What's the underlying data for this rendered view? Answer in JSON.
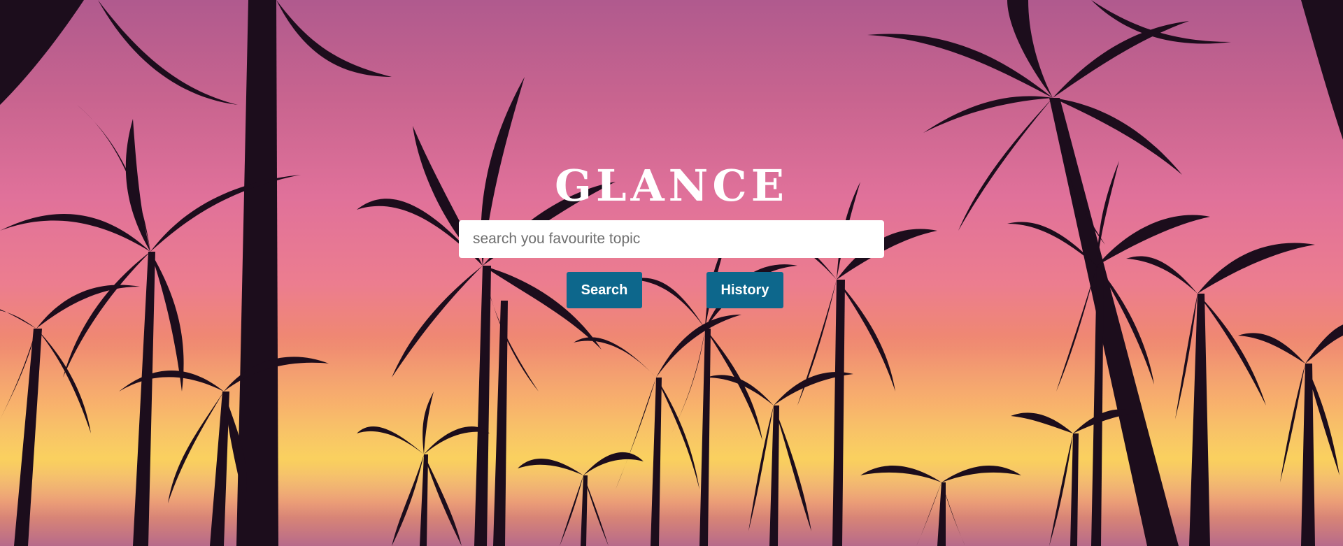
{
  "brand": {
    "title": "GLANCE"
  },
  "search": {
    "placeholder": "search you favourite topic",
    "value": ""
  },
  "buttons": {
    "search_label": "Search",
    "history_label": "History"
  },
  "colors": {
    "button_bg": "#0d678c",
    "button_text": "#ffffff",
    "title_text": "#ffffff",
    "sky_top": "#b05a8e",
    "sky_middle": "#e0719a",
    "sky_horizon": "#f7c84f",
    "silhouette": "#1c0d1c"
  },
  "background": {
    "description_icon": "palm-trees-sunset-photo"
  }
}
